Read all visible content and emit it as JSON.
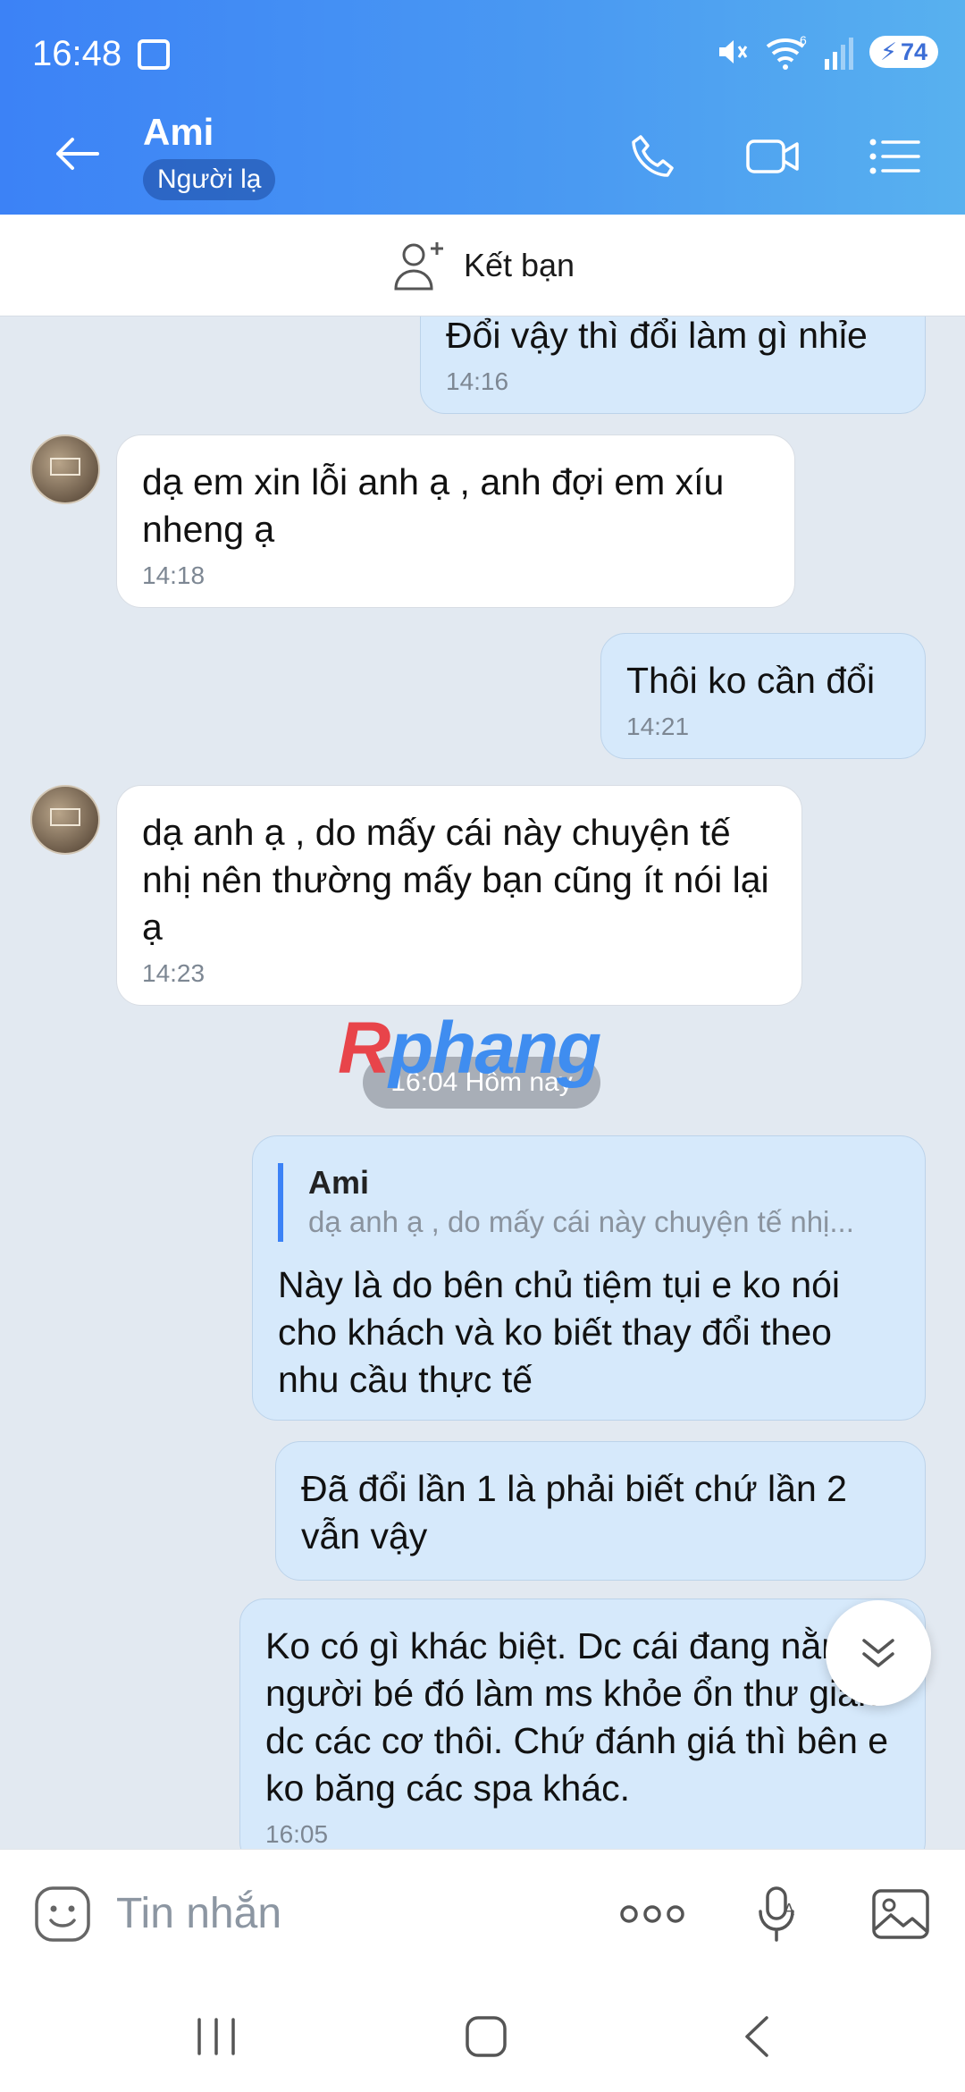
{
  "status_bar": {
    "time": "16:48",
    "battery": "74",
    "wifi_badge": "6"
  },
  "header": {
    "contact_name": "Ami",
    "badge": "Người lạ"
  },
  "friend_bar": {
    "label": "Kết bạn"
  },
  "messages": [
    {
      "dir": "out",
      "text": "Đổi vậy thì đổi làm gì nhỉe",
      "time": "14:16"
    },
    {
      "dir": "in",
      "text": "dạ em xin lỗi anh ạ , anh đợi em xíu nheng ạ",
      "time": "14:18"
    },
    {
      "dir": "out",
      "text": "Thôi ko cần đổi",
      "time": "14:21"
    },
    {
      "dir": "in",
      "text": "dạ anh ạ , do mấy cái này chuyện tế nhị nên thường mấy bạn cũng ít nói lại ạ",
      "time": "14:23"
    },
    {
      "dir": "out",
      "quote_name": "Ami",
      "quote_text": "dạ anh ạ , do mấy cái này chuyện tế nhị...",
      "text": "Này là do bên chủ tiệm tụi e ko nói cho khách và ko biết thay đổi theo nhu cầu thực tế"
    },
    {
      "dir": "out",
      "text": "Đã đổi lần 1 là phải biết chứ lần 2 vẫn vậy"
    },
    {
      "dir": "out",
      "text": "Ko có gì khác biệt. Dc cái đang nằm người bé đó làm ms khỏe ổn thư giãn dc các cơ thôi. Chứ đánh giá thì bên e ko băng các spa khác.",
      "time": "16:05"
    }
  ],
  "date_divider": "16:04 Hôm nay",
  "watermark": {
    "first": "R",
    "rest": "phang"
  },
  "composer": {
    "placeholder": "Tin nhắn"
  },
  "colors": {
    "header_start": "#3c82f6",
    "header_end": "#58b1ef",
    "outgoing_bubble": "#d6e9fb",
    "incoming_bubble": "#ffffff",
    "chat_bg": "#e2e9f1"
  },
  "icons": [
    "back-arrow-icon",
    "phone-icon",
    "video-camera-icon",
    "menu-list-icon",
    "add-friend-icon",
    "sticker-icon",
    "more-dots-icon",
    "voice-to-text-icon",
    "image-icon",
    "chevron-down-icon"
  ]
}
